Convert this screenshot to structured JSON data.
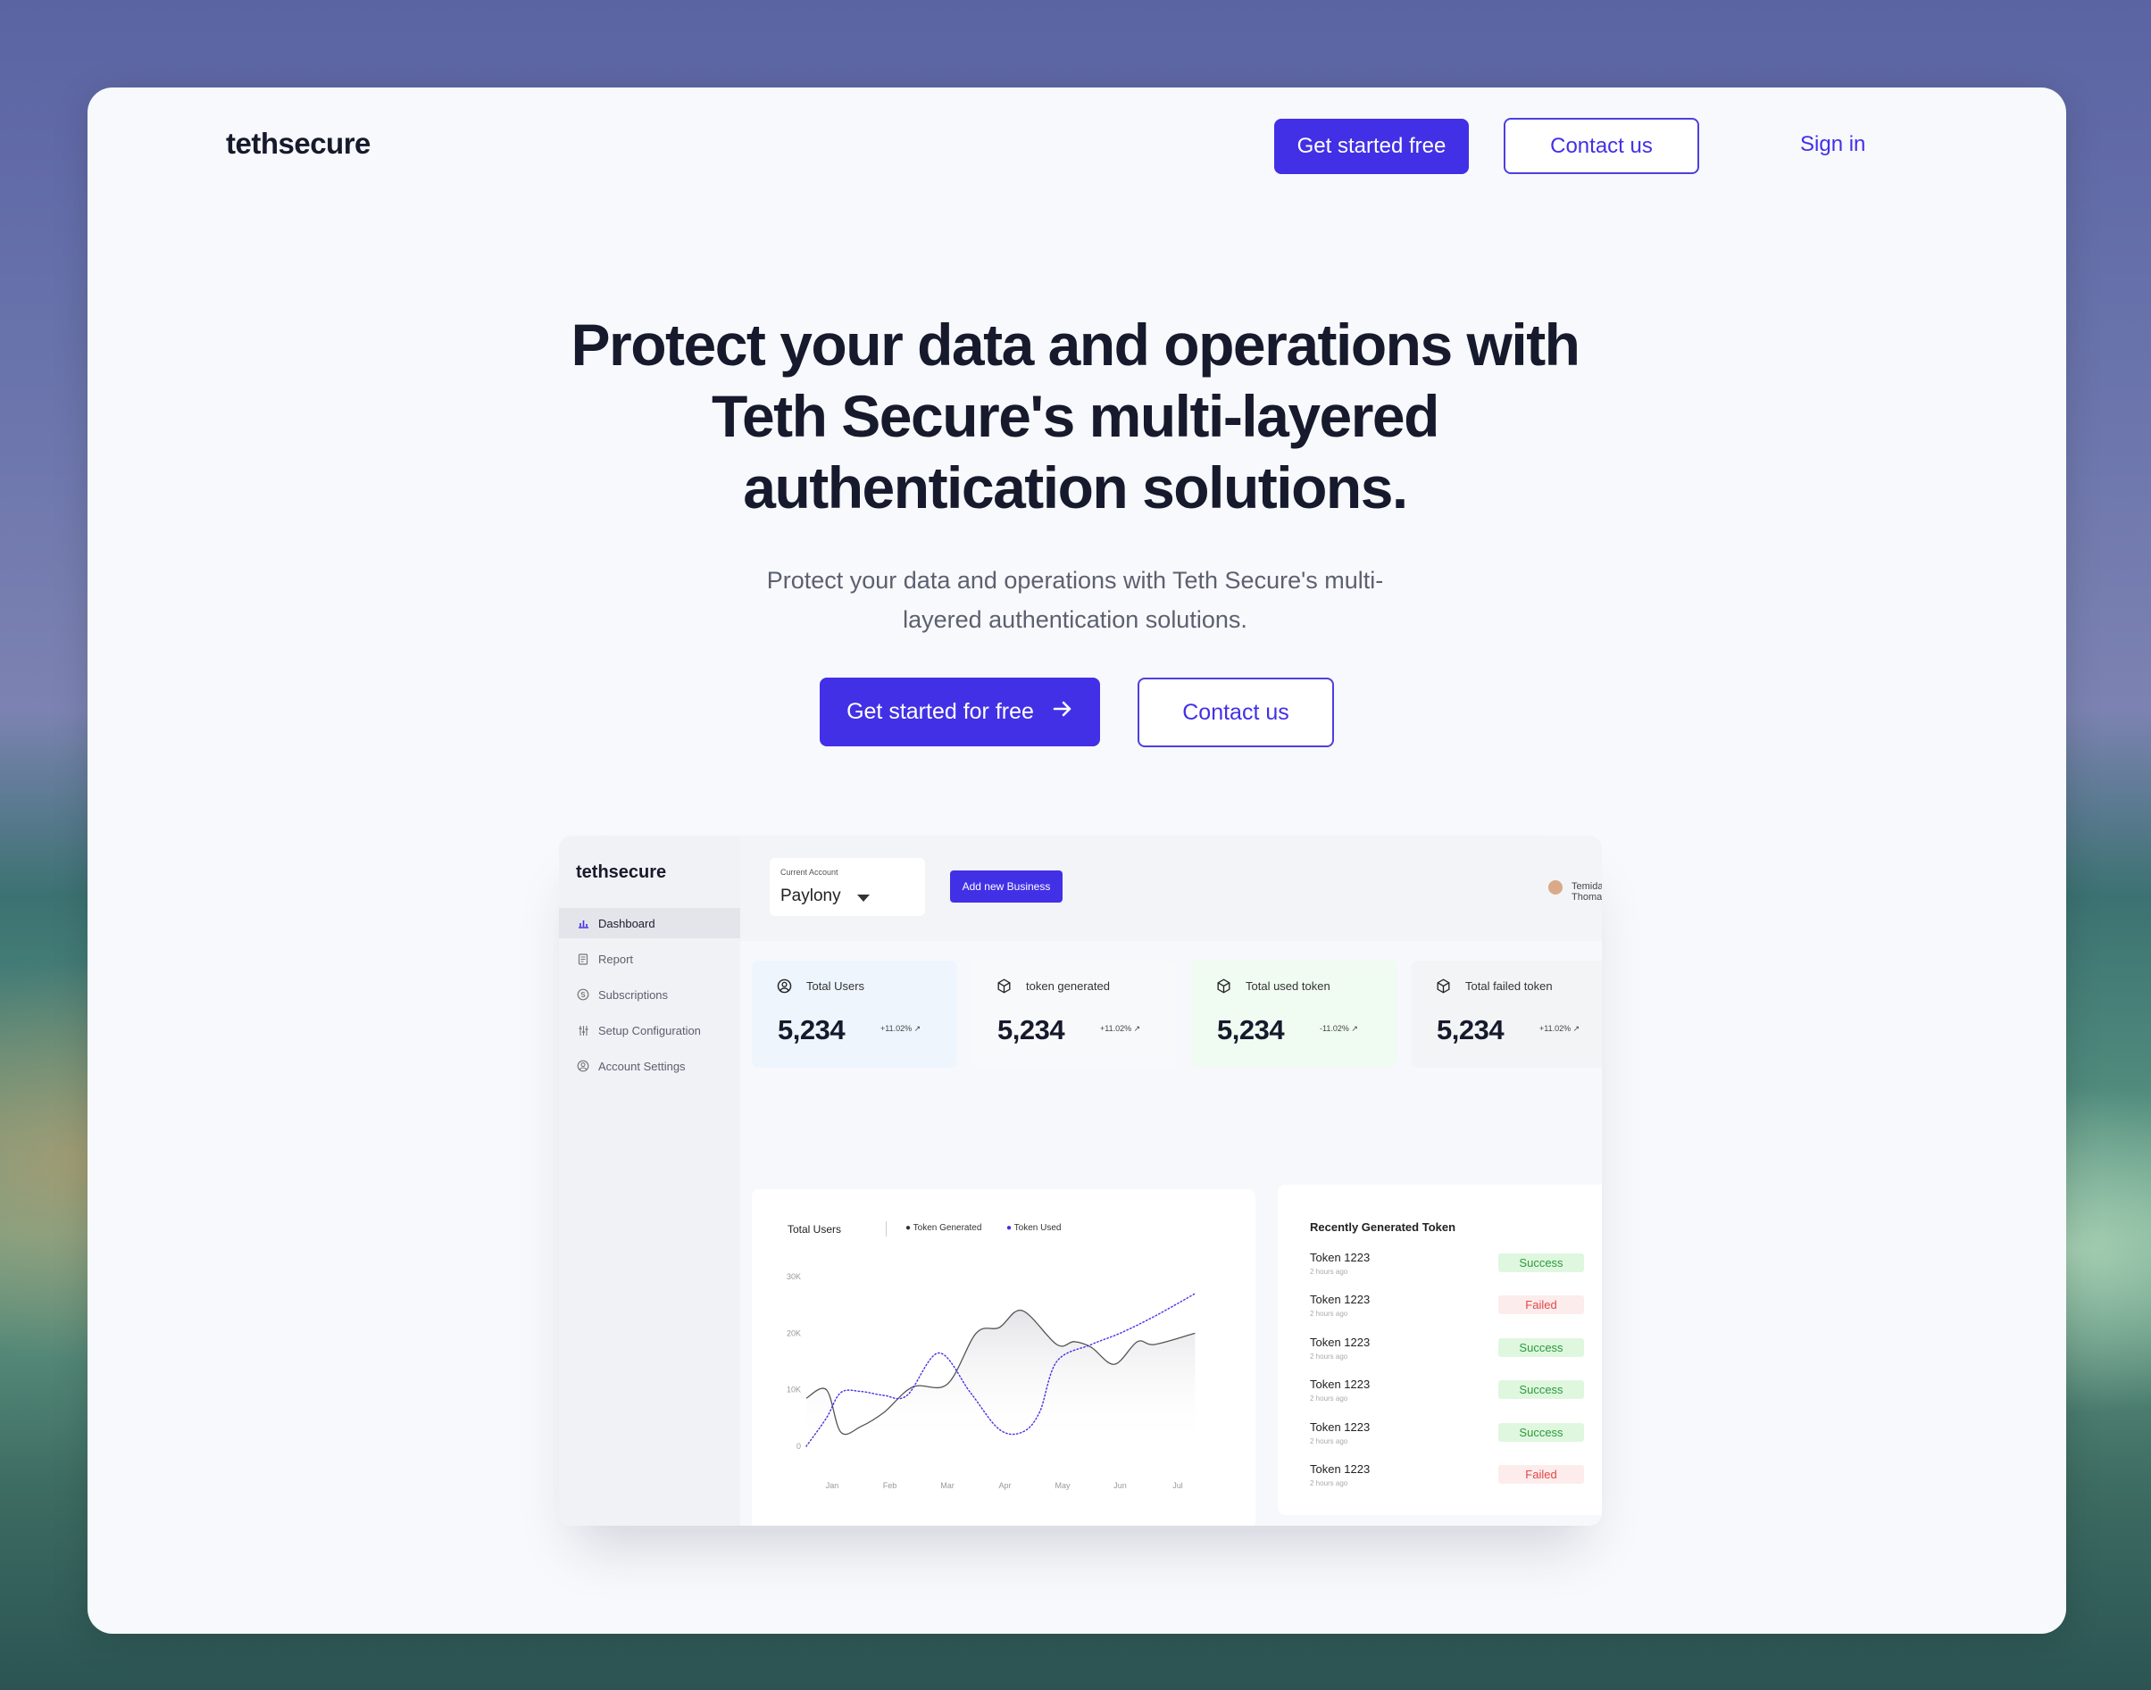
{
  "nav": {
    "logo": "tethsecure",
    "get_started": "Get started free",
    "contact": "Contact us",
    "signin": "Sign in"
  },
  "hero": {
    "title": "Protect your data and operations with Teth Secure's multi-layered authentication solutions.",
    "subtitle": "Protect your data and operations with Teth Secure's multi-layered authentication solutions.",
    "cta_primary": "Get started for free",
    "cta_secondary": "Contact us"
  },
  "colors": {
    "brand": "#4230e6",
    "text": "#161a2c"
  },
  "dashboard": {
    "logo": "tethsecure",
    "sidebar": [
      {
        "label": "Dashboard",
        "icon": "bar-chart-icon",
        "active": true
      },
      {
        "label": "Report",
        "icon": "report-icon",
        "active": false
      },
      {
        "label": "Subscriptions",
        "icon": "subscriptions-icon",
        "active": false
      },
      {
        "label": "Setup Configuration",
        "icon": "sliders-icon",
        "active": false
      },
      {
        "label": "Account Settings",
        "icon": "user-circle-icon",
        "active": false
      }
    ],
    "account": {
      "label": "Current Account",
      "value": "Paylony"
    },
    "add_business": "Add new Business",
    "user_name": "Temidayo Thomas",
    "stats": [
      {
        "label": "Total Users",
        "value": "5,234",
        "delta": "+11.02%",
        "icon": "user-circle-icon"
      },
      {
        "label": "token generated",
        "value": "5,234",
        "delta": "+11.02%",
        "icon": "cube-icon"
      },
      {
        "label": "Total used token",
        "value": "5,234",
        "delta": "-11.02%",
        "icon": "cube-icon"
      },
      {
        "label": "Total failed token",
        "value": "5,234",
        "delta": "+11.02%",
        "icon": "cube-icon"
      }
    ],
    "recent": {
      "title": "Recently Generated Token",
      "items": [
        {
          "name": "Token 1223",
          "time": "2 hours ago",
          "status": "Success"
        },
        {
          "name": "Token 1223",
          "time": "2 hours ago",
          "status": "Failed"
        },
        {
          "name": "Token 1223",
          "time": "2 hours ago",
          "status": "Success"
        },
        {
          "name": "Token 1223",
          "time": "2 hours ago",
          "status": "Success"
        },
        {
          "name": "Token 1223",
          "time": "2 hours ago",
          "status": "Success"
        },
        {
          "name": "Token 1223",
          "time": "2 hours ago",
          "status": "Failed"
        }
      ]
    }
  },
  "chart_data": {
    "type": "line",
    "title": "Total Users",
    "categories": [
      "Jan",
      "Feb",
      "Mar",
      "Apr",
      "May",
      "Jun",
      "Jul"
    ],
    "y_ticks": [
      "0",
      "10K",
      "20K",
      "30K"
    ],
    "ylim": [
      0,
      30000
    ],
    "legend_placement": "top",
    "series": [
      {
        "name": "Token Generated",
        "style": "solid",
        "color": "#555555",
        "x": [
          -0.45,
          -0.1,
          0.15,
          0.5,
          0.9,
          1.4,
          2.0,
          2.5,
          2.9,
          3.3,
          3.9,
          4.2,
          4.5,
          4.9,
          5.3,
          5.6,
          6.3
        ],
        "y": [
          8500,
          10000,
          2500,
          3500,
          6000,
          10500,
          11000,
          20000,
          21000,
          24000,
          18000,
          18500,
          17500,
          14500,
          18500,
          18000,
          20000
        ]
      },
      {
        "name": "Token Used",
        "style": "dotted",
        "color": "#4230e6",
        "x": [
          -0.45,
          -0.1,
          0.15,
          0.5,
          0.9,
          1.3,
          1.85,
          2.4,
          2.9,
          3.3,
          3.6,
          3.9,
          4.5,
          5.0,
          5.6,
          6.3
        ],
        "y": [
          0,
          5000,
          9500,
          9700,
          9000,
          9000,
          16500,
          9500,
          3000,
          2500,
          6000,
          15000,
          18000,
          20000,
          23000,
          27000
        ]
      }
    ]
  }
}
